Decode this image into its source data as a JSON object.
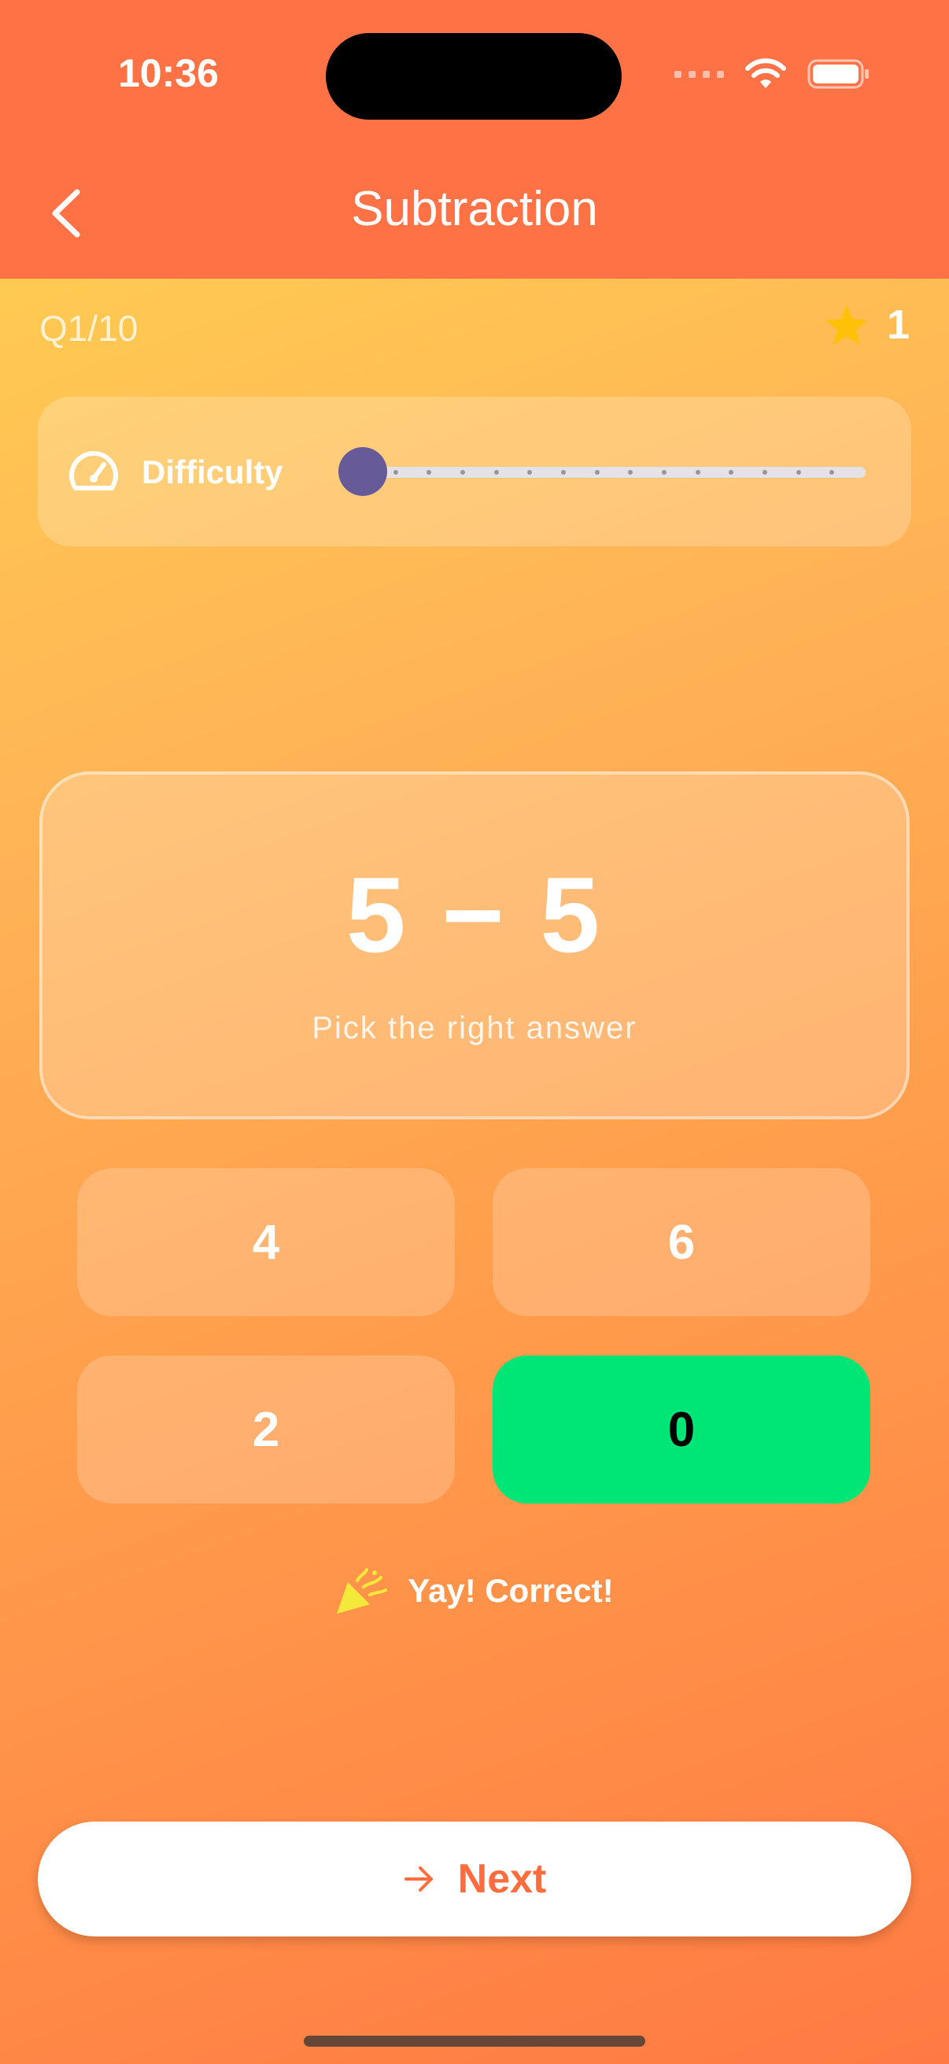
{
  "status_bar": {
    "time": "10:36",
    "icons": [
      "cellular-icon",
      "wifi-icon",
      "battery-icon"
    ]
  },
  "nav": {
    "title": "Subtraction",
    "back_icon": "chevron-left-icon"
  },
  "progress": {
    "question_counter": "Q1/10"
  },
  "score": {
    "icon": "star-icon",
    "value": "1"
  },
  "difficulty": {
    "label": "Difficulty",
    "icon": "speedometer-icon",
    "level": 1,
    "steps": 15
  },
  "question": {
    "equation": "5 − 5",
    "hint": "Pick the right answer"
  },
  "answers": [
    {
      "label": "4",
      "state": "default"
    },
    {
      "label": "6",
      "state": "default"
    },
    {
      "label": "2",
      "state": "default"
    },
    {
      "label": "0",
      "state": "correct"
    }
  ],
  "feedback": {
    "icon": "party-popper-icon",
    "text": "Yay! Correct!"
  },
  "next_button": {
    "label": "Next",
    "icon": "arrow-right-icon"
  },
  "colors": {
    "header": "#ff7245",
    "correct": "#00e676",
    "accent": "#ff6d3f",
    "slider_thumb": "#665a99",
    "star": "#ffc107"
  }
}
